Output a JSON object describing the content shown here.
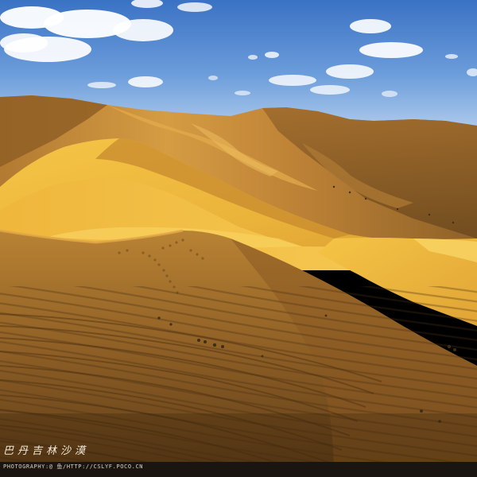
{
  "photo": {
    "title_calligraphy": "巴丹吉林沙漠",
    "credit_line": "PHOTOGRAPHY:@ 鱼/HTTP://CSLYF.POCO.CN"
  },
  "scene": {
    "subject": "sand dunes under a partly cloudy blue sky",
    "colors": {
      "sky_top": "#3f78c9",
      "sky_horizon": "#a9c9ec",
      "sand_lit": "#f2bb3a",
      "sand_mid": "#d99a37",
      "sand_shadow": "#9a6a2f",
      "sand_deep_shadow": "#5f3f1d"
    }
  }
}
